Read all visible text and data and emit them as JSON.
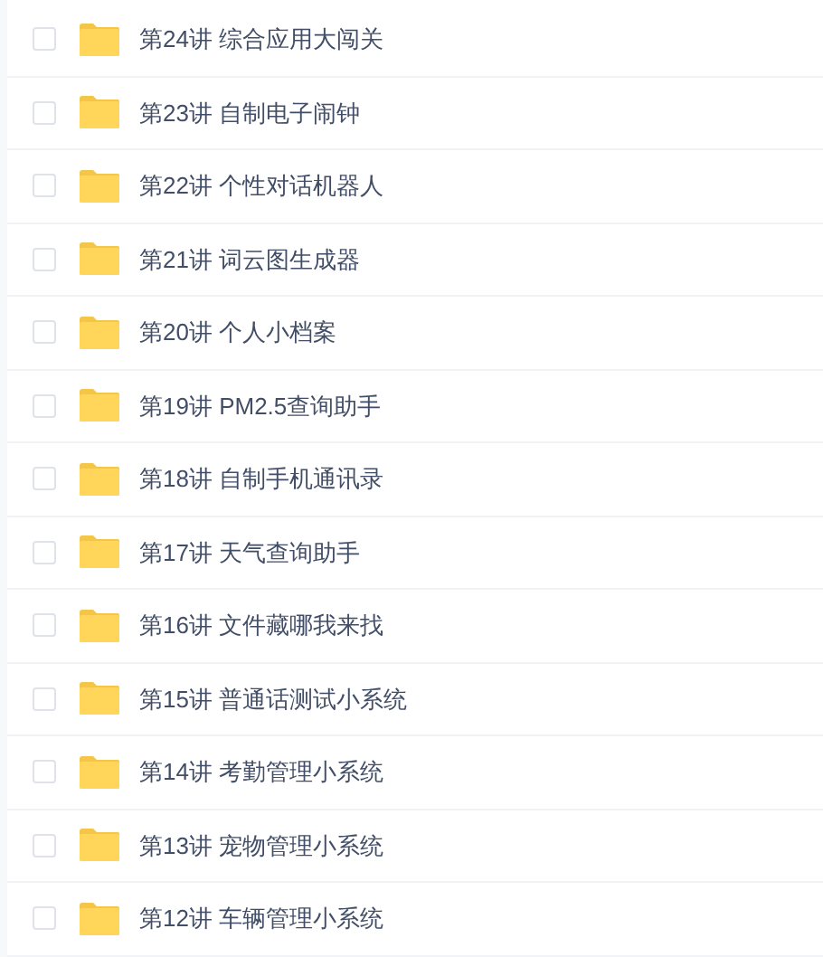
{
  "files": [
    {
      "name": "第24讲 综合应用大闯关",
      "checked": false
    },
    {
      "name": "第23讲 自制电子闹钟",
      "checked": false
    },
    {
      "name": "第22讲 个性对话机器人",
      "checked": false
    },
    {
      "name": "第21讲 词云图生成器",
      "checked": false
    },
    {
      "name": "第20讲 个人小档案",
      "checked": false
    },
    {
      "name": "第19讲 PM2.5查询助手",
      "checked": false
    },
    {
      "name": "第18讲 自制手机通讯录",
      "checked": false
    },
    {
      "name": "第17讲 天气查询助手",
      "checked": false
    },
    {
      "name": "第16讲 文件藏哪我来找",
      "checked": false
    },
    {
      "name": "第15讲 普通话测试小系统",
      "checked": false
    },
    {
      "name": "第14讲 考勤管理小系统",
      "checked": false
    },
    {
      "name": "第13讲 宠物管理小系统",
      "checked": false
    },
    {
      "name": "第12讲 车辆管理小系统",
      "checked": false
    }
  ]
}
